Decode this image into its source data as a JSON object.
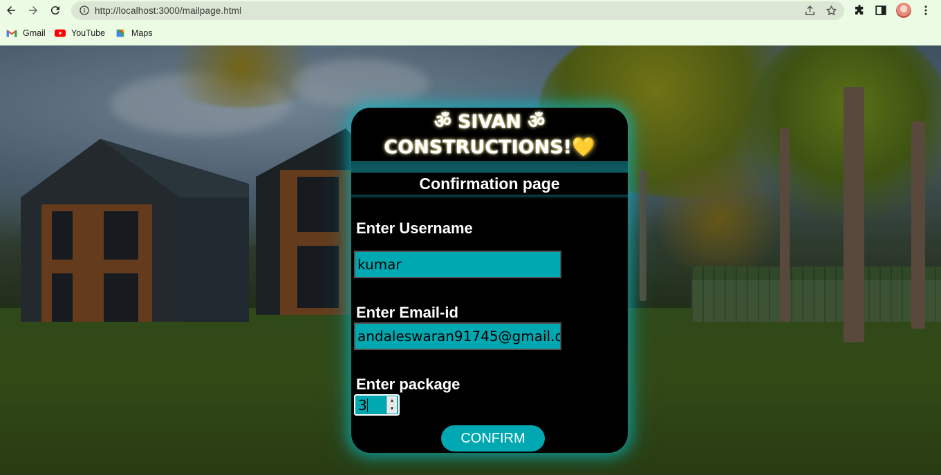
{
  "browser": {
    "url": "http://localhost:3000/mailpage.html",
    "bookmarks": [
      {
        "label": "Gmail",
        "icon": "gmail-icon"
      },
      {
        "label": "YouTube",
        "icon": "youtube-icon"
      },
      {
        "label": "Maps",
        "icon": "maps-icon"
      }
    ]
  },
  "card": {
    "brand_line1": "ॐ SIVAN ॐ",
    "brand_line2": "CONSTRUCTIONS!",
    "brand_heart": "💛",
    "subtitle": "Confirmation page",
    "username_label": "Enter Username",
    "username_value": "kumar",
    "email_label": "Enter Email-id",
    "email_value": "andaleswaran91745@gmail.c",
    "package_label": "Enter package",
    "package_value": "3",
    "confirm_label": "CONFIRM"
  },
  "colors": {
    "accent": "#00a8b2",
    "card_bg": "#000000",
    "toolbar_bg": "#ecfbe3",
    "heart": "#ffd200"
  }
}
